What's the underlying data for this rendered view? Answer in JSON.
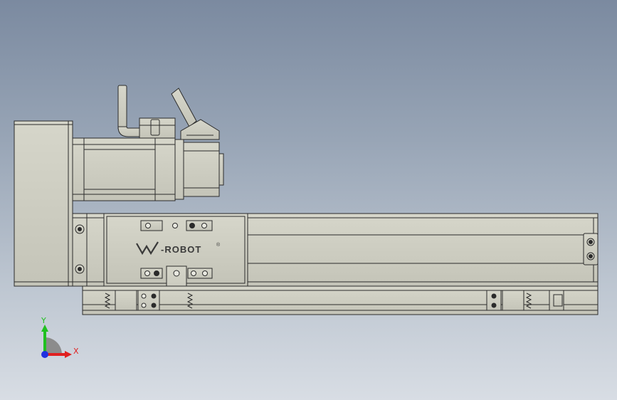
{
  "viewport": {
    "background_top": "#7b8aa0",
    "background_bottom": "#d8dde4"
  },
  "model": {
    "part_color": "#c8c8bc",
    "line_color": "#2b2b2b",
    "logo_text": "-ROBOT",
    "logo_mark": "®"
  },
  "triad": {
    "x_label": "X",
    "y_label": "Y",
    "x_color": "#e02020",
    "y_color": "#20c020",
    "z_color": "#2030e0"
  }
}
